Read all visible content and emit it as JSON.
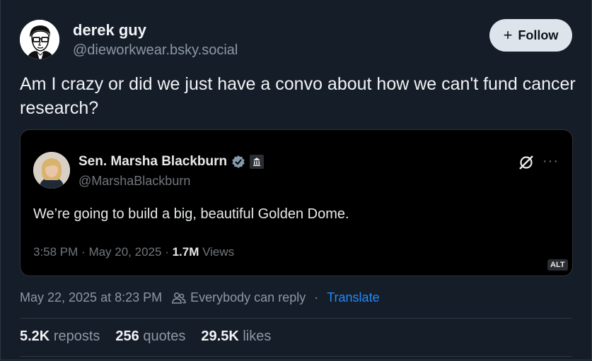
{
  "post": {
    "author_name": "derek guy",
    "author_handle": "@dieworkwear.bsky.social",
    "follow_label": "Follow",
    "text": "Am I crazy or did we just have a convo about how we can't fund cancer research?",
    "timestamp": "May 22, 2025 at 8:23 PM",
    "reply_setting": "Everybody can reply",
    "translate_label": "Translate"
  },
  "quote": {
    "author_name": "Sen. Marsha Blackburn",
    "author_handle": "@MarshaBlackburn",
    "text": "We’re going to build a big, beautiful Golden Dome.",
    "time": "3:58 PM",
    "date": "May 20, 2025",
    "views_count": "1.7M",
    "views_label": "Views",
    "alt_label": "ALT"
  },
  "stats": {
    "reposts_count": "5.2K",
    "reposts_label": "reposts",
    "quotes_count": "256",
    "quotes_label": "quotes",
    "likes_count": "29.5K",
    "likes_label": "likes"
  },
  "colors": {
    "background": "#151d28",
    "accent": "#208bfe",
    "verified": "#829aab"
  },
  "icons": {
    "reply": "people-icon",
    "verified": "verified-badge-icon",
    "government": "government-building-icon",
    "grok": "grok-icon",
    "more": "more-icon"
  }
}
